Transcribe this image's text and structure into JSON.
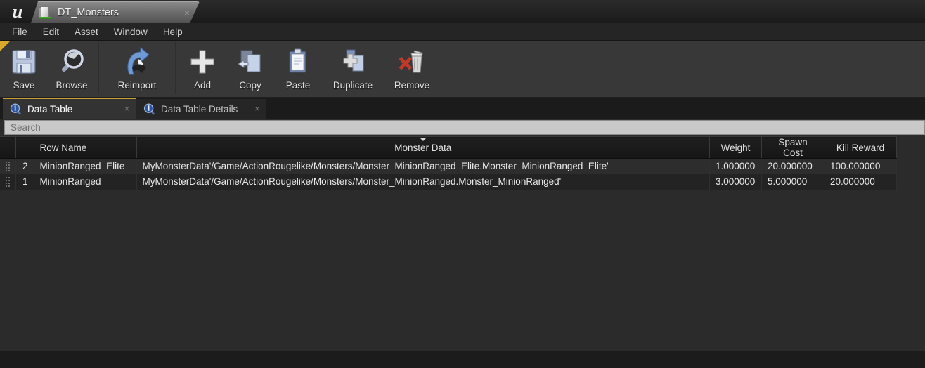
{
  "window": {
    "logo_icon": "unreal-engine-logo",
    "asset_tab": {
      "label": "DT_Monsters",
      "icon": "data-table-asset-icon",
      "close": "×"
    }
  },
  "menu": {
    "items": [
      "File",
      "Edit",
      "Asset",
      "Window",
      "Help"
    ]
  },
  "toolbar": {
    "buttons": [
      {
        "label": "Save",
        "icon": "save-floppy-icon"
      },
      {
        "label": "Browse",
        "icon": "browse-magnifier-icon"
      },
      {
        "label": "Reimport",
        "icon": "reimport-arrow-icon"
      },
      {
        "label": "Add",
        "icon": "add-plus-icon"
      },
      {
        "label": "Copy",
        "icon": "copy-pages-icon"
      },
      {
        "label": "Paste",
        "icon": "paste-clipboard-icon"
      },
      {
        "label": "Duplicate",
        "icon": "duplicate-pages-plus-icon"
      },
      {
        "label": "Remove",
        "icon": "remove-trash-icon"
      }
    ]
  },
  "panel_tabs": [
    {
      "label": "Data Table",
      "icon": "info-magnifier-icon",
      "active": true,
      "close": "×"
    },
    {
      "label": "Data Table Details",
      "icon": "info-magnifier-icon",
      "active": false,
      "close": "×"
    }
  ],
  "search": {
    "placeholder": "Search",
    "value": ""
  },
  "table": {
    "columns": [
      {
        "label": "",
        "key": "grip"
      },
      {
        "label": "",
        "key": "index"
      },
      {
        "label": "Row Name",
        "key": "row_name"
      },
      {
        "label": "Monster Data",
        "key": "monster_data",
        "sorted": true,
        "sort_dir": "desc"
      },
      {
        "label": "Weight",
        "key": "weight"
      },
      {
        "label": "Spawn Cost",
        "key": "spawn_cost"
      },
      {
        "label": "Kill Reward",
        "key": "kill_reward"
      }
    ],
    "rows": [
      {
        "index": "2",
        "row_name": "MinionRanged_Elite",
        "monster_data": "MyMonsterData'/Game/ActionRougelike/Monsters/Monster_MinionRanged_Elite.Monster_MinionRanged_Elite'",
        "weight": "1.000000",
        "spawn_cost": "20.000000",
        "kill_reward": "100.000000"
      },
      {
        "index": "1",
        "row_name": "MinionRanged",
        "monster_data": "MyMonsterData'/Game/ActionRougelike/Monsters/Monster_MinionRanged.Monster_MinionRanged'",
        "weight": "3.000000",
        "spawn_cost": "5.000000",
        "kill_reward": "20.000000"
      }
    ]
  },
  "colors": {
    "accent_gold": "#c8a030",
    "panel_bg": "#2b2b2b",
    "toolbar_bg": "#383838",
    "header_bg": "#1a1a1a",
    "row_odd": "#2d2d2d",
    "row_even": "#232323",
    "search_bg": "#c9c9c9"
  }
}
